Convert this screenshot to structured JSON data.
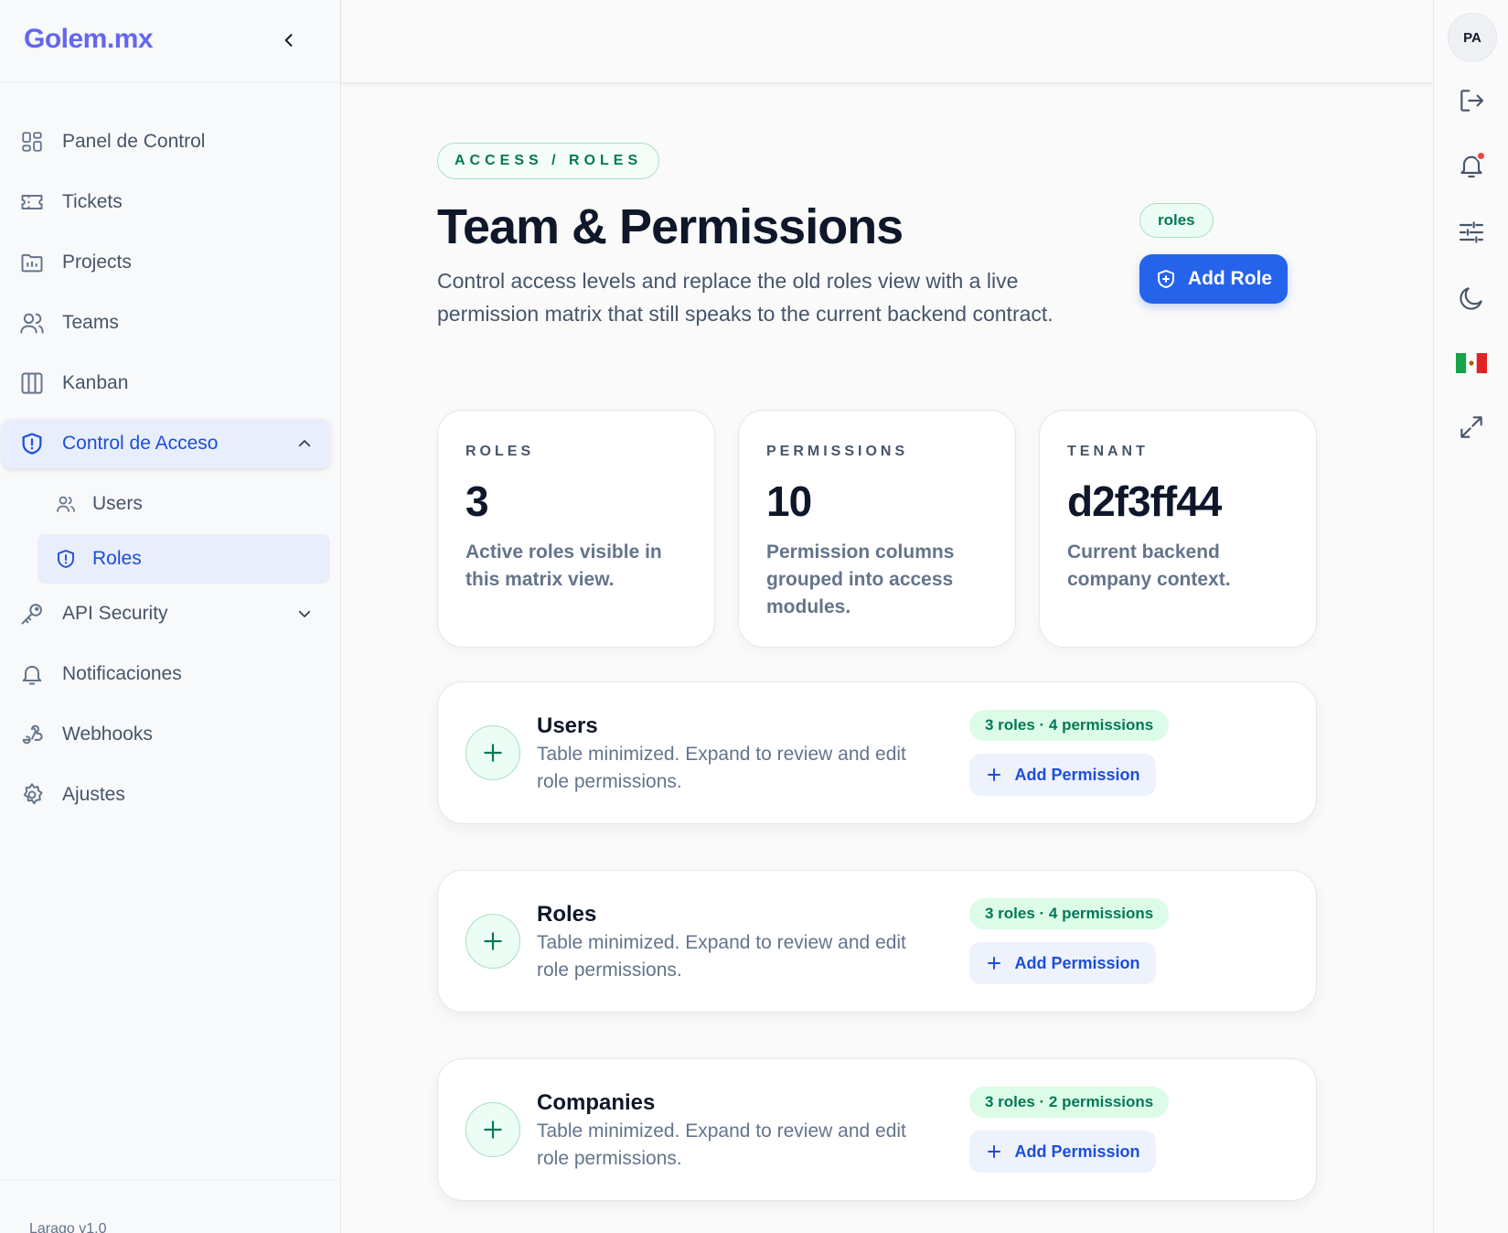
{
  "app": {
    "logo": "Golem.mx",
    "version": "Larago v1.0"
  },
  "sidebar": {
    "items": [
      {
        "label": "Panel de Control",
        "icon": "dashboard-icon"
      },
      {
        "label": "Tickets",
        "icon": "ticket-icon"
      },
      {
        "label": "Projects",
        "icon": "folder-icon"
      },
      {
        "label": "Teams",
        "icon": "users-icon"
      },
      {
        "label": "Kanban",
        "icon": "columns-icon"
      },
      {
        "label": "Control de Acceso",
        "icon": "shield-icon",
        "active": true,
        "expanded": true
      },
      {
        "label": "API Security",
        "icon": "key-icon",
        "expanded": false
      },
      {
        "label": "Notificaciones",
        "icon": "bell-icon"
      },
      {
        "label": "Webhooks",
        "icon": "webhook-icon"
      },
      {
        "label": "Ajustes",
        "icon": "gear-icon"
      }
    ],
    "subitems": [
      {
        "label": "Users",
        "icon": "user-group-icon"
      },
      {
        "label": "Roles",
        "icon": "shield-icon",
        "active": true
      }
    ]
  },
  "rail": {
    "avatar": "PA",
    "icons": [
      "logout-icon",
      "bell-icon",
      "sliders-icon",
      "moon-icon",
      "mexico-flag-icon",
      "fullscreen-icon"
    ],
    "notification_dot_color": "#ef4444"
  },
  "page": {
    "breadcrumb": "ACCESS / ROLES",
    "title": "Team & Permissions",
    "description": "Control access levels and replace the old roles view with a live permission matrix that still speaks to the current backend contract.",
    "tag": "roles",
    "add_role": "Add Role"
  },
  "stats": [
    {
      "label": "ROLES",
      "value": "3",
      "desc": "Active roles visible in this matrix view."
    },
    {
      "label": "PERMISSIONS",
      "value": "10",
      "desc": "Permission columns grouped into access modules."
    },
    {
      "label": "TENANT",
      "value": "d2f3ff44",
      "desc": "Current backend company context."
    }
  ],
  "modules": [
    {
      "title": "Users",
      "desc": "Table minimized. Expand to review and edit role permissions.",
      "badge": "3 roles · 4 permissions",
      "action": "Add Permission"
    },
    {
      "title": "Roles",
      "desc": "Table minimized. Expand to review and edit role permissions.",
      "badge": "3 roles · 4 permissions",
      "action": "Add Permission"
    },
    {
      "title": "Companies",
      "desc": "Table minimized. Expand to review and edit role permissions.",
      "badge": "3 roles · 2 permissions",
      "action": "Add Permission"
    }
  ],
  "colors": {
    "brand": "#6366f1",
    "primary": "#2563eb",
    "accent_green": "#047857",
    "active_bg": "#e8eefc"
  }
}
